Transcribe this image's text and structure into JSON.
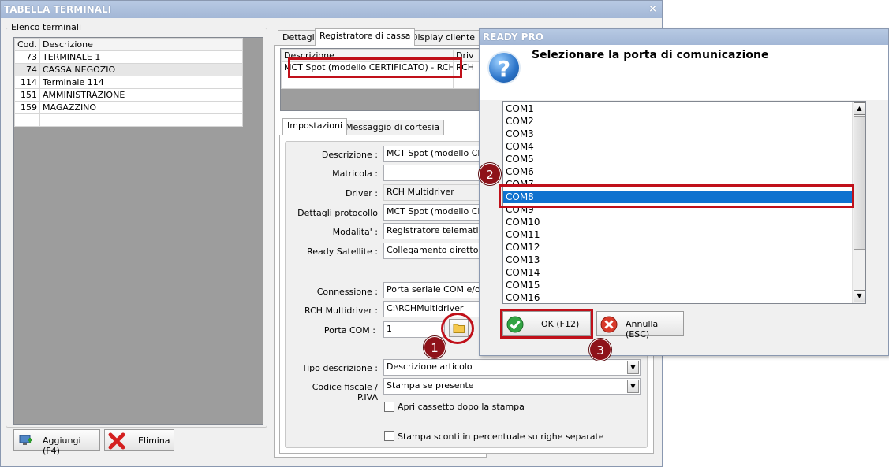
{
  "main_window": {
    "title": "TABELLA TERMINALI",
    "close_glyph": "×",
    "terminals_group_label": "Elenco terminali",
    "columns": {
      "code": "Cod.",
      "description": "Descrizione"
    },
    "terminals": [
      {
        "code": "73",
        "description": "TERMINALE 1"
      },
      {
        "code": "74",
        "description": "CASSA NEGOZIO"
      },
      {
        "code": "114",
        "description": "Terminale 114"
      },
      {
        "code": "151",
        "description": "AMMINISTRAZIONE"
      },
      {
        "code": "159",
        "description": "MAGAZZINO"
      }
    ],
    "add_button": "Aggiungi (F4)",
    "delete_button": "Elimina",
    "top_tabs": [
      "Dettagli",
      "Registratore di cassa",
      "Display cliente"
    ],
    "register_grid": {
      "col_description": "Descrizione",
      "col_driver": "Driv",
      "row_description": "MCT Spot (modello CERTIFICATO) - RCH ...",
      "row_driver": "RCH"
    },
    "sub_tabs": [
      "Impostazioni",
      "Messaggio di cortesia"
    ],
    "form": {
      "descrizione_label": "Descrizione :",
      "descrizione_value": "MCT Spot (modello CERTI",
      "matricola_label": "Matricola :",
      "matricola_value": "",
      "driver_label": "Driver :",
      "driver_value": "RCH Multidriver",
      "protocol_label": "Dettagli protocollo",
      "protocol_value": "MCT Spot (modello CERT",
      "mode_label": "Modalita' :",
      "mode_value": "Registratore telematico",
      "satellite_label": "Ready Satellite :",
      "satellite_value": "Collegamento diretto",
      "connection_label": "Connessione :",
      "connection_value": "Porta seriale COM e/o US",
      "multidriver_label": "RCH Multidriver :",
      "multidriver_value": "C:\\RCHMultidriver",
      "port_label": "Porta COM :",
      "port_value": "1",
      "desc_type_label": "Tipo descrizione :",
      "desc_type_value": "Descrizione articolo",
      "fiscal_label": "Codice fiscale / P.IVA",
      "fiscal_value": "Stampa se presente",
      "cashdrawer_check": "Apri cassetto dopo la stampa",
      "discount_check": "Stampa sconti in percentuale su righe separate"
    }
  },
  "dialog": {
    "title": "READY PRO",
    "message": "Selezionare la porta di comunicazione",
    "icon_glyph": "?",
    "ports": [
      "COM1",
      "COM2",
      "COM3",
      "COM4",
      "COM5",
      "COM6",
      "COM7",
      "COM8",
      "COM9",
      "COM10",
      "COM11",
      "COM12",
      "COM13",
      "COM14",
      "COM15",
      "COM16"
    ],
    "selected_port": "COM8",
    "ok_button": "OK (F12)",
    "cancel_button": "Annulla (ESC)"
  },
  "annotations": [
    "1",
    "2",
    "3"
  ],
  "colors": {
    "highlight_red": "#c0101a",
    "selection_blue": "#0f72cf",
    "badge": "#8e1219",
    "title_bar": "#a3b7d6"
  }
}
